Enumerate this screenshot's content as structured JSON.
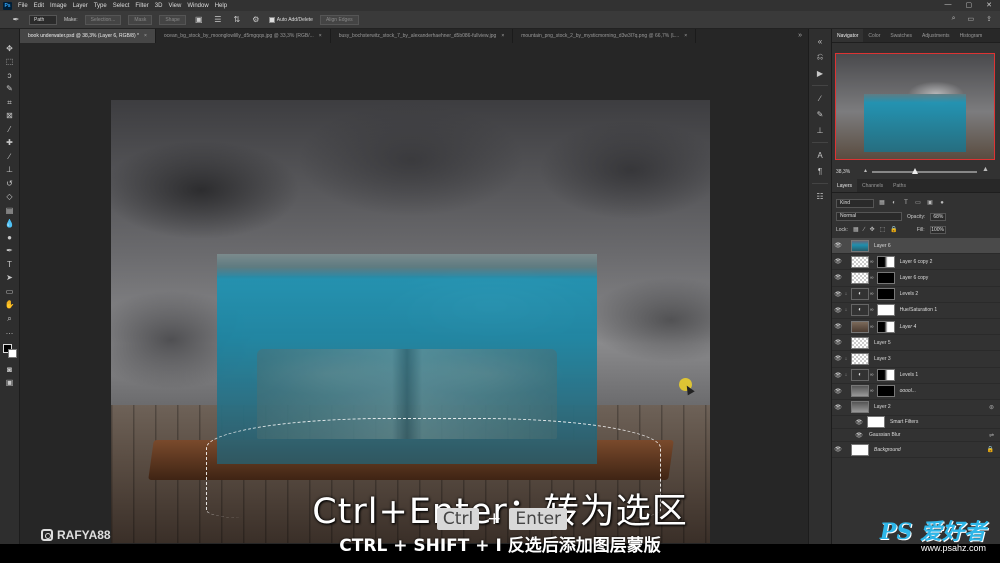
{
  "menubar": {
    "logo": "Ps",
    "items": [
      "File",
      "Edit",
      "Image",
      "Layer",
      "Type",
      "Select",
      "Filter",
      "3D",
      "View",
      "Window",
      "Help"
    ],
    "controls": [
      "—",
      "▢",
      "✕"
    ]
  },
  "options": {
    "mode": "Path",
    "make_label": "Make:",
    "selection_btn": "Selection...",
    "mask_btn": "Mask",
    "shape_btn": "Shape",
    "auto_add_delete": "Auto Add/Delete",
    "align_edges": "Align Edges"
  },
  "tabs": [
    {
      "label": "book underwater.psd @ 38,3% (Layer 6, RGB/8) *",
      "active": true
    },
    {
      "label": "ocean_bg_stock_by_moonglowlilly_d5mgqqs.jpg @ 33,3% (RGB/...",
      "active": false
    },
    {
      "label": "busy_bochsterwitz_stock_7_by_alexanderhaehner_d5b086-fullview.jpg",
      "active": false
    },
    {
      "label": "mountain_png_stock_2_by_mysticmorning_d3w3l7q.png @ 66,7% (L...",
      "active": false
    }
  ],
  "navigator": {
    "tabs": [
      "Navigator",
      "Color",
      "Swatches",
      "Adjustments",
      "Histogram"
    ],
    "zoom": "38,3%"
  },
  "layers_panel": {
    "tabs": [
      "Layers",
      "Channels",
      "Paths"
    ],
    "kind": "Kind",
    "blend_mode": "Normal",
    "opacity_label": "Opacity:",
    "opacity": "68%",
    "lock_label": "Lock:",
    "fill_label": "Fill:",
    "fill": "100%",
    "layers": [
      {
        "name": "Layer 6",
        "thumb": "water",
        "mask": "",
        "active": true,
        "italic": false,
        "clip": false
      },
      {
        "name": "Layer 6 copy 2",
        "thumb": "checker",
        "mask": "mixed",
        "active": false,
        "italic": false,
        "clip": false
      },
      {
        "name": "Layer 6 copy",
        "thumb": "checker",
        "mask": "black",
        "active": false,
        "italic": false,
        "clip": false
      },
      {
        "name": "Levels 2",
        "thumb": "adj",
        "mask": "black",
        "active": false,
        "italic": false,
        "clip": true
      },
      {
        "name": "Hue/Saturation 1",
        "thumb": "adj",
        "mask": "white",
        "active": false,
        "italic": false,
        "clip": true
      },
      {
        "name": "Layer 4",
        "thumb": "photo",
        "mask": "mixed",
        "active": false,
        "italic": true,
        "clip": false
      },
      {
        "name": "Layer 5",
        "thumb": "checker",
        "mask": "",
        "active": false,
        "italic": false,
        "clip": false
      },
      {
        "name": "Layer 3",
        "thumb": "checker",
        "mask": "",
        "active": false,
        "italic": false,
        "clip": true
      },
      {
        "name": "Levels 1",
        "thumb": "adj",
        "mask": "mixed",
        "active": false,
        "italic": false,
        "clip": true
      },
      {
        "name": "ooool...",
        "thumb": "sky",
        "mask": "black",
        "active": false,
        "italic": true,
        "clip": false
      },
      {
        "name": "Layer 2",
        "thumb": "sky",
        "mask": "",
        "active": false,
        "italic": false,
        "clip": false
      }
    ],
    "smart_filters": "Smart Filters",
    "gaussian_blur": "Gaussian Blur",
    "background": "Background"
  },
  "captions": {
    "main": "Ctrl+Enter：转为选区",
    "ghost_key1": "Ctrl",
    "ghost_plus": "+",
    "ghost_key2": "Enter",
    "chinese": "CTRL + SHIFT + I 反选后添加图层蒙版"
  },
  "watermarks": {
    "brand": "RAFYA88",
    "site_logo": "PS 爱好者",
    "site_url": "www.psahz.com"
  }
}
